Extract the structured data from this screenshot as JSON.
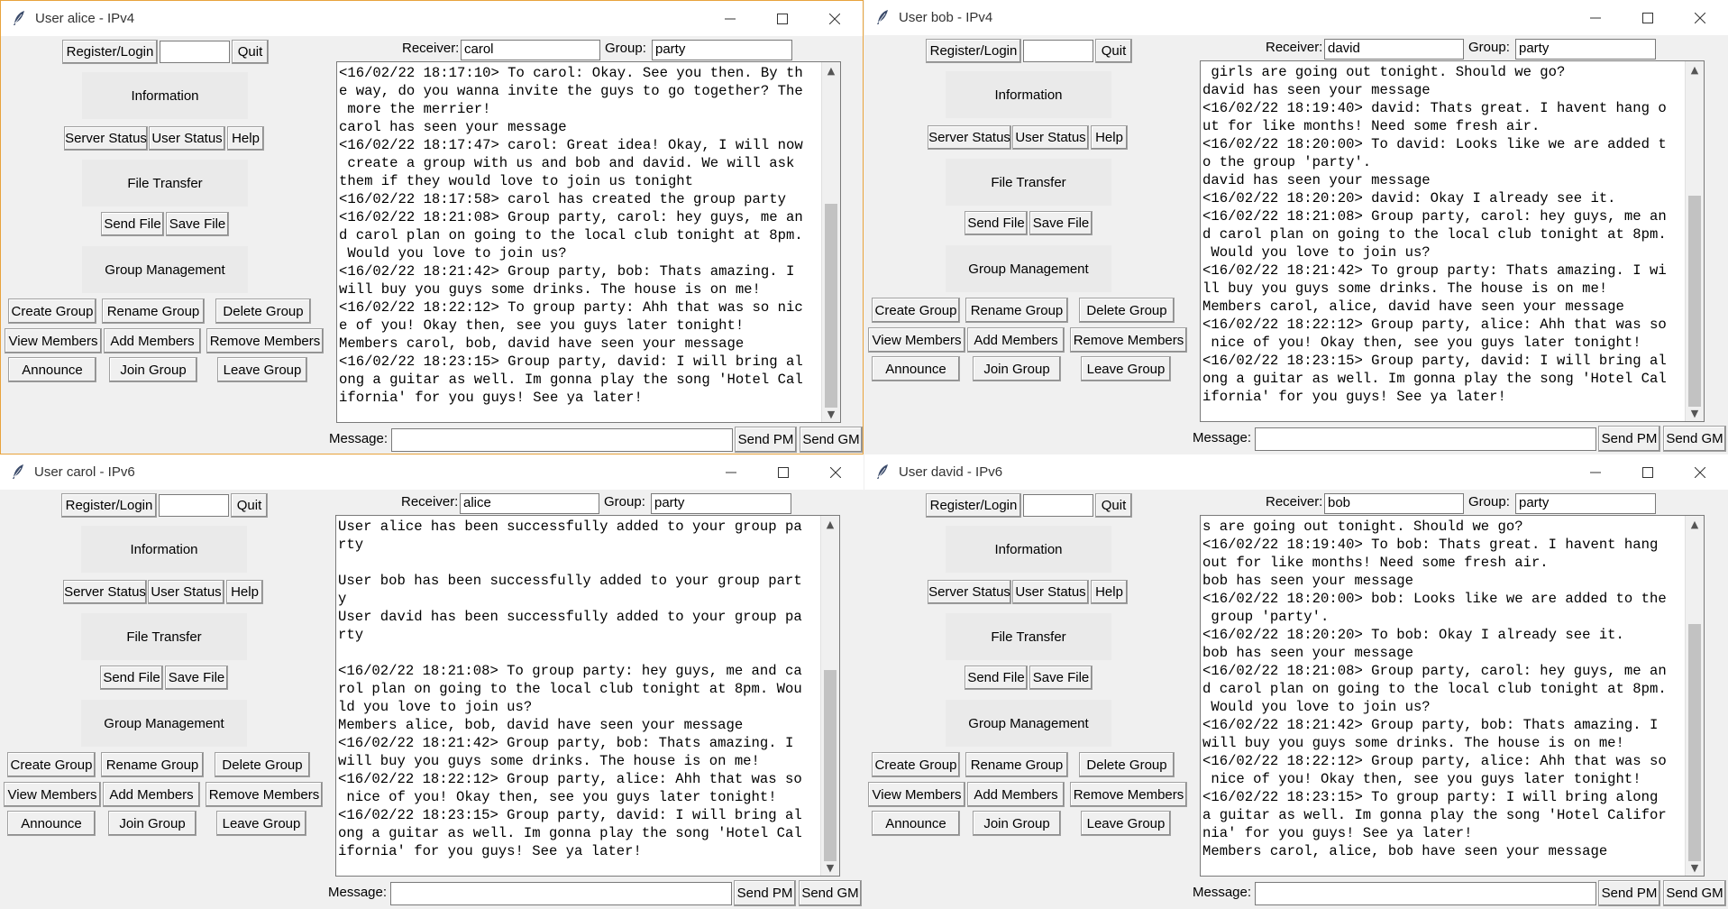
{
  "labels": {
    "register": "Register/Login",
    "quit": "Quit",
    "information": "Information",
    "server_status": "Server Status",
    "user_status": "User Status",
    "help": "Help",
    "file_transfer": "File Transfer",
    "send_file": "Send File",
    "save_file": "Save File",
    "group_management": "Group Management",
    "create_group": "Create Group",
    "rename_group": "Rename Group",
    "delete_group": "Delete Group",
    "view_members": "View Members",
    "add_members": "Add Members",
    "remove_members": "Remove Members",
    "announce": "Announce",
    "join_group": "Join Group",
    "leave_group": "Leave Group",
    "receiver": "Receiver:",
    "group": "Group:",
    "message": "Message:",
    "send_pm": "Send PM",
    "send_gm": "Send GM"
  },
  "windows": [
    {
      "title": "User alice - IPv4",
      "active": true,
      "receiver": "carol",
      "group": "party",
      "message": "",
      "scroll": {
        "thumb_top": 0.38,
        "thumb_size": 0.62
      },
      "chat_lines": [
        "<16/02/22 18:17:10> To carol: Okay. See you then. By th",
        "e way, do you wanna invite the guys to go together? The",
        " more the merrier!",
        "carol has seen your message",
        "<16/02/22 18:17:47> carol: Great idea! Okay, I will now",
        " create a group with us and bob and david. We will ask",
        "them if they would love to join us tonight",
        "<16/02/22 18:17:58> carol has created the group party",
        "<16/02/22 18:21:08> Group party, carol: hey guys, me an",
        "d carol plan on going to the local club tonight at 8pm.",
        " Would you love to join us?",
        "<16/02/22 18:21:42> Group party, bob: Thats amazing. I",
        "will buy you guys some drinks. The house is on me!",
        "<16/02/22 18:22:12> To group party: Ahh that was so nic",
        "e of you! Okay then, see you guys later tonight!",
        "Members carol, bob, david have seen your message",
        "<16/02/22 18:23:15> Group party, david: I will bring al",
        "ong a guitar as well. Im gonna play the song 'Hotel Cal",
        "ifornia' for you guys! See ya later!"
      ]
    },
    {
      "title": "User bob - IPv4",
      "active": false,
      "receiver": "david",
      "group": "party",
      "message": "",
      "scroll": {
        "thumb_top": 0.36,
        "thumb_size": 0.64
      },
      "chat_lines": [
        " girls are going out tonight. Should we go?",
        "david has seen your message",
        "<16/02/22 18:19:40> david: Thats great. I havent hang o",
        "ut for like months! Need some fresh air.",
        "<16/02/22 18:20:00> To david: Looks like we are added t",
        "o the group 'party'.",
        "david has seen your message",
        "<16/02/22 18:20:20> david: Okay I already see it.",
        "<16/02/22 18:21:08> Group party, carol: hey guys, me an",
        "d carol plan on going to the local club tonight at 8pm.",
        " Would you love to join us?",
        "<16/02/22 18:21:42> To group party: Thats amazing. I wi",
        "ll buy you guys some drinks. The house is on me!",
        "Members carol, alice, david have seen your message",
        "<16/02/22 18:22:12> Group party, alice: Ahh that was so",
        " nice of you! Okay then, see you guys later tonight!",
        "<16/02/22 18:23:15> Group party, david: I will bring al",
        "ong a guitar as well. Im gonna play the song 'Hotel Cal",
        "ifornia' for you guys! See ya later!"
      ]
    },
    {
      "title": "User carol - IPv6",
      "active": false,
      "receiver": "alice",
      "group": "party",
      "message": "",
      "scroll": {
        "thumb_top": 0.42,
        "thumb_size": 0.58
      },
      "chat_lines": [
        "User alice has been successfully added to your group pa",
        "rty",
        "",
        "User bob has been successfully added to your group part",
        "y",
        "User david has been successfully added to your group pa",
        "rty",
        "",
        "<16/02/22 18:21:08> To group party: hey guys, me and ca",
        "rol plan on going to the local club tonight at 8pm. Wou",
        "ld you love to join us?",
        "Members alice, bob, david have seen your message",
        "<16/02/22 18:21:42> Group party, bob: Thats amazing. I",
        "will buy you guys some drinks. The house is on me!",
        "<16/02/22 18:22:12> Group party, alice: Ahh that was so",
        " nice of you! Okay then, see you guys later tonight!",
        "<16/02/22 18:23:15> Group party, david: I will bring al",
        "ong a guitar as well. Im gonna play the song 'Hotel Cal",
        "ifornia' for you guys! See ya later!"
      ]
    },
    {
      "title": "User david - IPv6",
      "active": false,
      "receiver": "bob",
      "group": "party",
      "message": "",
      "scroll": {
        "thumb_top": 0.28,
        "thumb_size": 0.72
      },
      "chat_lines": [
        "s are going out tonight. Should we go?",
        "<16/02/22 18:19:40> To bob: Thats great. I havent hang",
        "out for like months! Need some fresh air.",
        "bob has seen your message",
        "<16/02/22 18:20:00> bob: Looks like we are added to the",
        " group 'party'.",
        "<16/02/22 18:20:20> To bob: Okay I already see it.",
        "bob has seen your message",
        "<16/02/22 18:21:08> Group party, carol: hey guys, me an",
        "d carol plan on going to the local club tonight at 8pm.",
        " Would you love to join us?",
        "<16/02/22 18:21:42> Group party, bob: Thats amazing. I",
        "will buy you guys some drinks. The house is on me!",
        "<16/02/22 18:22:12> Group party, alice: Ahh that was so",
        " nice of you! Okay then, see you guys later tonight!",
        "<16/02/22 18:23:15> To group party: I will bring along",
        "a guitar as well. Im gonna play the song 'Hotel Califor",
        "nia' for you guys! See ya later!",
        "Members carol, alice, bob have seen your message"
      ]
    }
  ]
}
